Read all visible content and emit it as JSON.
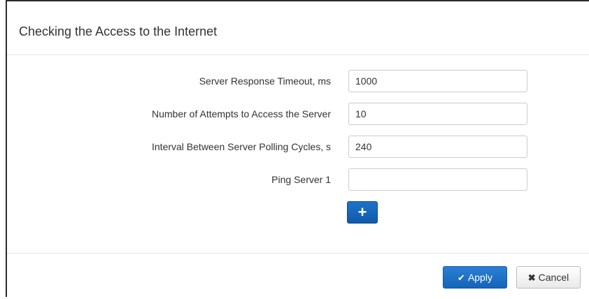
{
  "dialog": {
    "title": "Checking the Access to the Internet"
  },
  "fields": [
    {
      "label": "Server Response Timeout, ms",
      "value": "1000",
      "placeholder": ""
    },
    {
      "label": "Number of Attempts to Access the Server",
      "value": "10",
      "placeholder": ""
    },
    {
      "label": "Interval Between Server Polling Cycles, s",
      "value": "240",
      "placeholder": ""
    },
    {
      "label": "Ping Server 1",
      "value": "",
      "placeholder": ""
    }
  ],
  "add_button": {
    "icon": "plus-icon",
    "glyph": "+"
  },
  "footer": {
    "apply": {
      "label": "Apply",
      "icon": "check-icon",
      "glyph": "✔"
    },
    "cancel": {
      "label": "Cancel",
      "icon": "close-icon",
      "glyph": "✖"
    }
  },
  "colors": {
    "primary": "#1a6dc4",
    "border": "#cccccc",
    "text": "#333333"
  }
}
